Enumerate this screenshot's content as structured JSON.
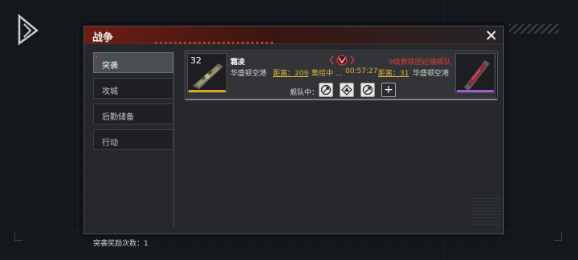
{
  "panel": {
    "title": "战争",
    "close_icon": "close-icon"
  },
  "sidebar": {
    "items": [
      {
        "label": "突袭",
        "active": true
      },
      {
        "label": "攻城",
        "active": false
      },
      {
        "label": "后勤储备",
        "active": false
      },
      {
        "label": "行动",
        "active": false
      }
    ],
    "reward_count": "突袭奖励次数：1"
  },
  "card": {
    "level": "32",
    "ship_name": "霜凌",
    "left_location": "华盛顿空港",
    "left_distance": "距离：209",
    "status": "集结中 ...",
    "timer": "00:57:27",
    "right_distance": "距离：31",
    "right_location": "华盛顿空港",
    "enemy_name": "9级救赎团运输舰队",
    "fleet_label": "舰队中：",
    "fleet_slots": [
      "fleet-unit-icon",
      "fleet-unit-icon",
      "fleet-unit-icon"
    ],
    "add_label": "+"
  },
  "colors": {
    "header_red": "#6e1d14",
    "accent_yellow": "#e0b433",
    "enemy_red": "#d83c3c",
    "left_rarity": "#d9a524",
    "right_rarity": "#a256d8"
  }
}
